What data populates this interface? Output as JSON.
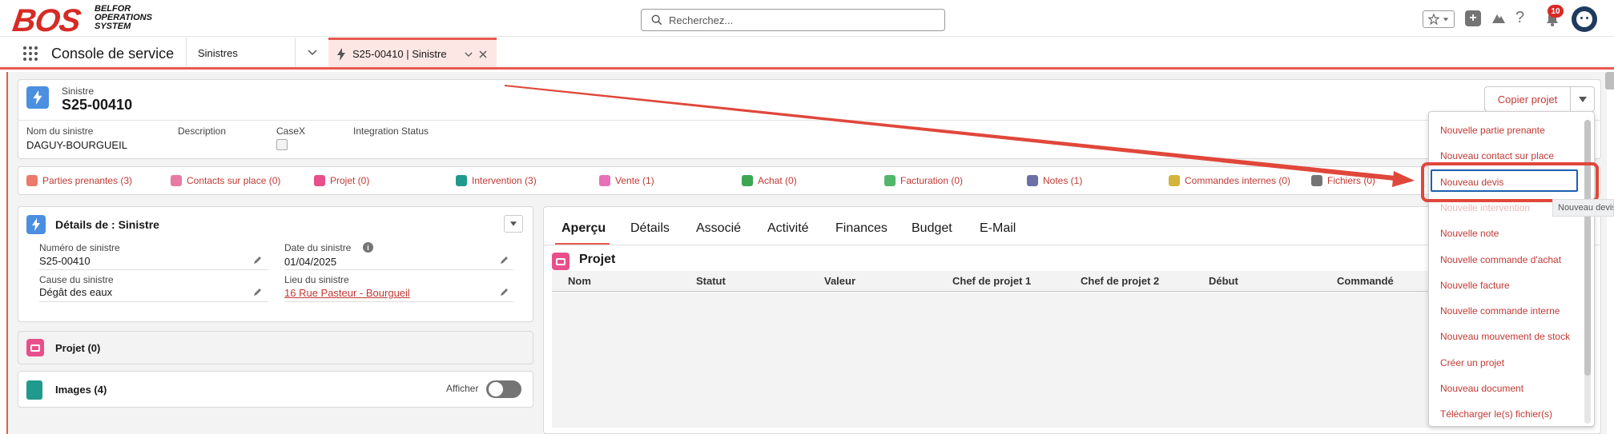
{
  "brand": {
    "logo": "BOS",
    "sub_line1": "BELFOR",
    "sub_line2": "OPERATIONS",
    "sub_line3": "SYSTEM",
    "accent": "#d62b24"
  },
  "search": {
    "placeholder": "Recherchez..."
  },
  "header_icons": {
    "notifications_count": "10",
    "help": "?",
    "icons": [
      "star-icon",
      "chevron-down-icon",
      "add-icon",
      "trailhead-icon",
      "help-icon",
      "bell-icon",
      "avatar"
    ]
  },
  "nav": {
    "app_name": "Console de service",
    "tabs": [
      {
        "label": "Sinistres"
      },
      {
        "label": "S25-00410 | Sinistre"
      }
    ]
  },
  "record": {
    "object_label": "Sinistre",
    "name": "S25-00410",
    "fields": [
      {
        "label": "Nom du sinistre",
        "value": "DAGUY-BOURGUEIL"
      },
      {
        "label": "Description",
        "value": ""
      },
      {
        "label": "CaseX",
        "value": ""
      },
      {
        "label": "Integration Status",
        "value": ""
      }
    ]
  },
  "actions": {
    "copy_label": "Copier projet"
  },
  "related": [
    {
      "label": "Parties prenantes (3)",
      "color": "#ec7a6d"
    },
    {
      "label": "Contacts sur place (0)",
      "color": "#e87aa3"
    },
    {
      "label": "Projet (0)",
      "color": "#e94f8a"
    },
    {
      "label": "Intervention (3)",
      "color": "#1f9a8c"
    },
    {
      "label": "Vente (1)",
      "color": "#e771b6"
    },
    {
      "label": "Achat (0)",
      "color": "#3ba755"
    },
    {
      "label": "Facturation (0)",
      "color": "#52b76b"
    },
    {
      "label": "Notes (1)",
      "color": "#6b6fa8"
    },
    {
      "label": "Commandes internes (0)",
      "color": "#d4b43a"
    },
    {
      "label": "Fichiers (0)",
      "color": "#747474"
    }
  ],
  "details": {
    "title": "Détails de : Sinistre",
    "fields": [
      {
        "label": "Numéro de sinistre",
        "value": "S25-00410"
      },
      {
        "label": "Date du sinistre",
        "value": "01/04/2025"
      },
      {
        "label": "Cause du sinistre",
        "value": "Dégât des eaux"
      },
      {
        "label": "Lieu du sinistre",
        "value": "16 Rue Pasteur - Bourgueil"
      }
    ]
  },
  "projet_card": {
    "title": "Projet (0)"
  },
  "images_card": {
    "title": "Images (4)",
    "toggle_label": "Afficher"
  },
  "main_tabs": [
    "Aperçu",
    "Détails",
    "Associé",
    "Activité",
    "Finances",
    "Budget",
    "E-Mail"
  ],
  "projet_list": {
    "title": "Projet",
    "columns": [
      "Nom",
      "Statut",
      "Valeur",
      "Chef de projet 1",
      "Chef de projet 2",
      "Début",
      "Commandé"
    ]
  },
  "dropdown": {
    "items": [
      "Nouvelle partie prenante",
      "Nouveau contact sur place",
      "Nouveau devis",
      "Nouvelle intervention",
      "Nouvelle note",
      "Nouvelle commande d'achat",
      "Nouvelle facture",
      "Nouvelle commande interne",
      "Nouveau mouvement de stock",
      "Créer un projet",
      "Nouveau document",
      "Télécharger le(s) fichier(s)"
    ],
    "tooltip": "Nouveau devis"
  },
  "colors": {
    "accent_red": "#e9594f",
    "link_red": "#c23934",
    "sinistre_blue": "#4a8fe0"
  }
}
